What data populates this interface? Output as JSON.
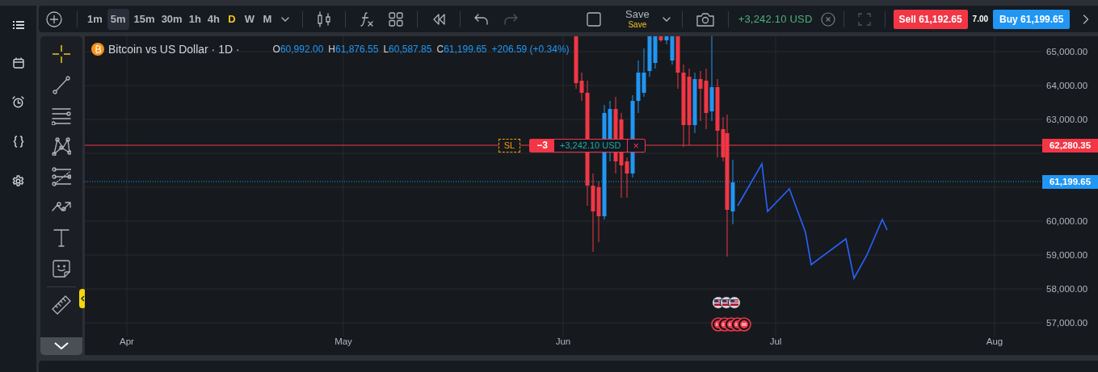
{
  "toolbar": {
    "timeframes": [
      {
        "label": "1m",
        "selected": false,
        "hovered": false
      },
      {
        "label": "5m",
        "selected": false,
        "hovered": true
      },
      {
        "label": "15m",
        "selected": false,
        "hovered": false
      },
      {
        "label": "30m",
        "selected": false,
        "hovered": false
      },
      {
        "label": "1h",
        "selected": false,
        "hovered": false
      },
      {
        "label": "4h",
        "selected": false,
        "hovered": false
      },
      {
        "label": "D",
        "selected": true,
        "hovered": false
      },
      {
        "label": "W",
        "selected": false,
        "hovered": false
      },
      {
        "label": "M",
        "selected": false,
        "hovered": false
      }
    ],
    "undo": {
      "disabled": false
    },
    "redo": {
      "disabled": true
    },
    "save": {
      "label": "Save",
      "sublabel": "Save"
    },
    "pnl": "+3,242.10 USD",
    "fullscreen": {
      "disabled": true
    },
    "sell": "Sell 61,192.65",
    "spread": "7.00",
    "buy": "Buy 61,199.65"
  },
  "drawing_tools": [
    {
      "kind": "crosshair",
      "selected": true
    },
    {
      "kind": "trend-line",
      "selected": false
    },
    {
      "kind": "parallel-lines",
      "selected": false
    },
    {
      "kind": "pattern",
      "selected": false
    },
    {
      "kind": "fibonacci",
      "selected": false
    },
    {
      "kind": "path",
      "selected": false
    },
    {
      "kind": "text",
      "selected": false
    },
    {
      "kind": "sticker",
      "selected": false
    },
    {
      "kind": "ruler",
      "selected": false
    }
  ],
  "chart": {
    "legend": {
      "symbol": "Bitcoin vs US Dollar · 1D ·",
      "ohlc": [
        {
          "label": "O",
          "value": "60,992.00"
        },
        {
          "label": "H",
          "value": "61,876.55"
        },
        {
          "label": "L",
          "value": "60,587.85"
        },
        {
          "label": "C",
          "value": "61,199.65"
        }
      ],
      "change": "+206.59 (+0.34%)"
    },
    "position": {
      "stop_tag": "SL",
      "quantity": "−3",
      "pnl": "+3,242.10 USD",
      "close": "×"
    },
    "price_axis": {
      "ticks": [
        "65,000.00",
        "64,000.00",
        "63,000.00",
        "60,000.00",
        "59,000.00",
        "58,000.00",
        "57,000.00"
      ],
      "labels": [
        {
          "kind": "stop",
          "text": "62,280.35"
        },
        {
          "kind": "last",
          "text": "61,199.65"
        }
      ]
    },
    "time_axis": [
      "Apr",
      "May",
      "Jun",
      "Jul",
      "Aug"
    ]
  }
}
